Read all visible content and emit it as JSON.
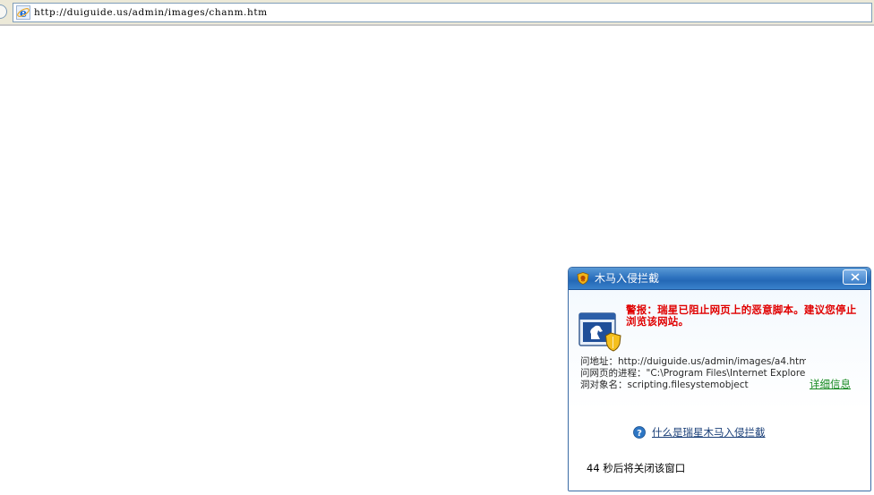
{
  "browser": {
    "address_url": "http://duiguide.us/admin/images/chanm.htm"
  },
  "popup": {
    "title": "木马入侵拦截",
    "warning": "警报：瑞星已阻止网页上的恶意脚本。建议您停止浏览该网站。",
    "details": {
      "address_line": "问地址：http://duiguide.us/admin/images/a4.htm",
      "process_line": "问网页的进程：\"C:\\Program Files\\Internet Explore",
      "object_line": "洞对象名：scripting.filesystemobject"
    },
    "details_link": "详细信息",
    "help_link": "什么是瑞星木马入侵拦截",
    "countdown": "44 秒后将关闭该窗口"
  },
  "colors": {
    "titlebar": "#2f73bf",
    "warning_red": "#e00000",
    "details_link_green": "#14891f",
    "help_link_blue": "#1a3f78"
  },
  "icons": {
    "address_bar": "ie-logo-icon",
    "title": "rising-lion-shield-icon",
    "close": "close-icon",
    "main": "browser-shield-icon",
    "help": "help-question-icon"
  }
}
